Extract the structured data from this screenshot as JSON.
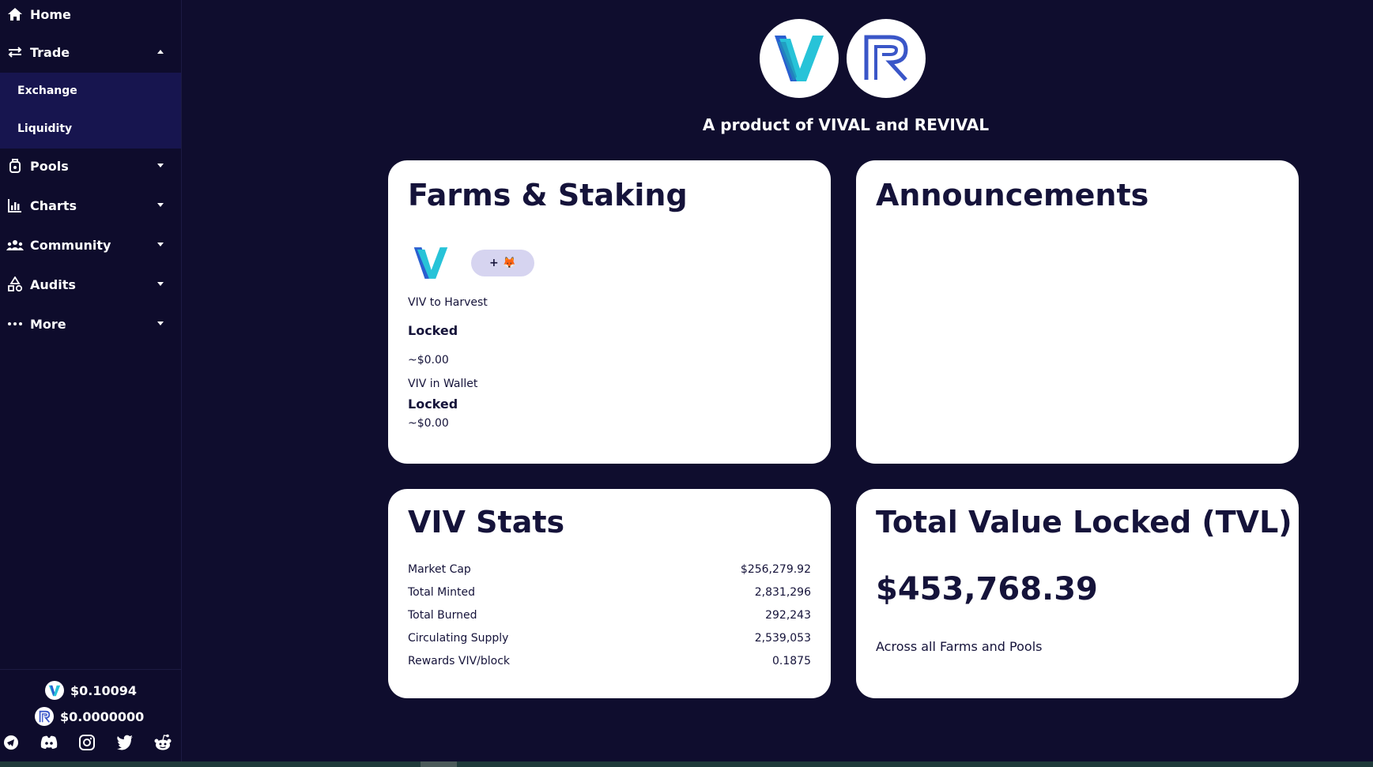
{
  "sidebar": {
    "items": [
      {
        "label": "Home",
        "icon": "home-icon"
      },
      {
        "label": "Trade",
        "icon": "swap-icon",
        "expanded": true
      },
      {
        "label": "Pools",
        "icon": "pools-icon"
      },
      {
        "label": "Charts",
        "icon": "chart-icon"
      },
      {
        "label": "Community",
        "icon": "community-icon"
      },
      {
        "label": "Audits",
        "icon": "audits-icon"
      },
      {
        "label": "More",
        "icon": "more-icon"
      }
    ],
    "trade_submenu": [
      {
        "label": "Exchange"
      },
      {
        "label": "Liquidity"
      }
    ],
    "prices": {
      "viv": "$0.10094",
      "rvl": "$0.0000000"
    },
    "socials": [
      "telegram-icon",
      "discord-icon",
      "instagram-icon",
      "twitter-icon",
      "reddit-icon"
    ]
  },
  "hero": {
    "tagline": "A product of VIVAL and REVIVAL"
  },
  "farms": {
    "title": "Farms & Staking",
    "add_token_label": "+ 🦊",
    "harvest_label": "VIV to Harvest",
    "harvest_value": "Locked",
    "harvest_usd": "~$0.00",
    "wallet_label": "VIV in Wallet",
    "wallet_value": "Locked",
    "wallet_usd": "~$0.00"
  },
  "announcements": {
    "title": "Announcements"
  },
  "stats": {
    "title": "VIV Stats",
    "rows": [
      {
        "label": "Market Cap",
        "value": "$256,279.92"
      },
      {
        "label": "Total Minted",
        "value": "2,831,296"
      },
      {
        "label": "Total Burned",
        "value": "292,243"
      },
      {
        "label": "Circulating Supply",
        "value": "2,539,053"
      },
      {
        "label": "Rewards VIV/block",
        "value": "0.1875"
      }
    ]
  },
  "tvl": {
    "title": "Total Value Locked (TVL)",
    "value": "$453,768.39",
    "caption": "Across all Farms and Pools"
  },
  "colors": {
    "background": "#0f0d2e",
    "submenu": "#17154f",
    "card": "#ffffff",
    "text_dark": "#15133a",
    "viv_cyan": "#27c3d8",
    "viv_blue": "#2a5fd0"
  }
}
